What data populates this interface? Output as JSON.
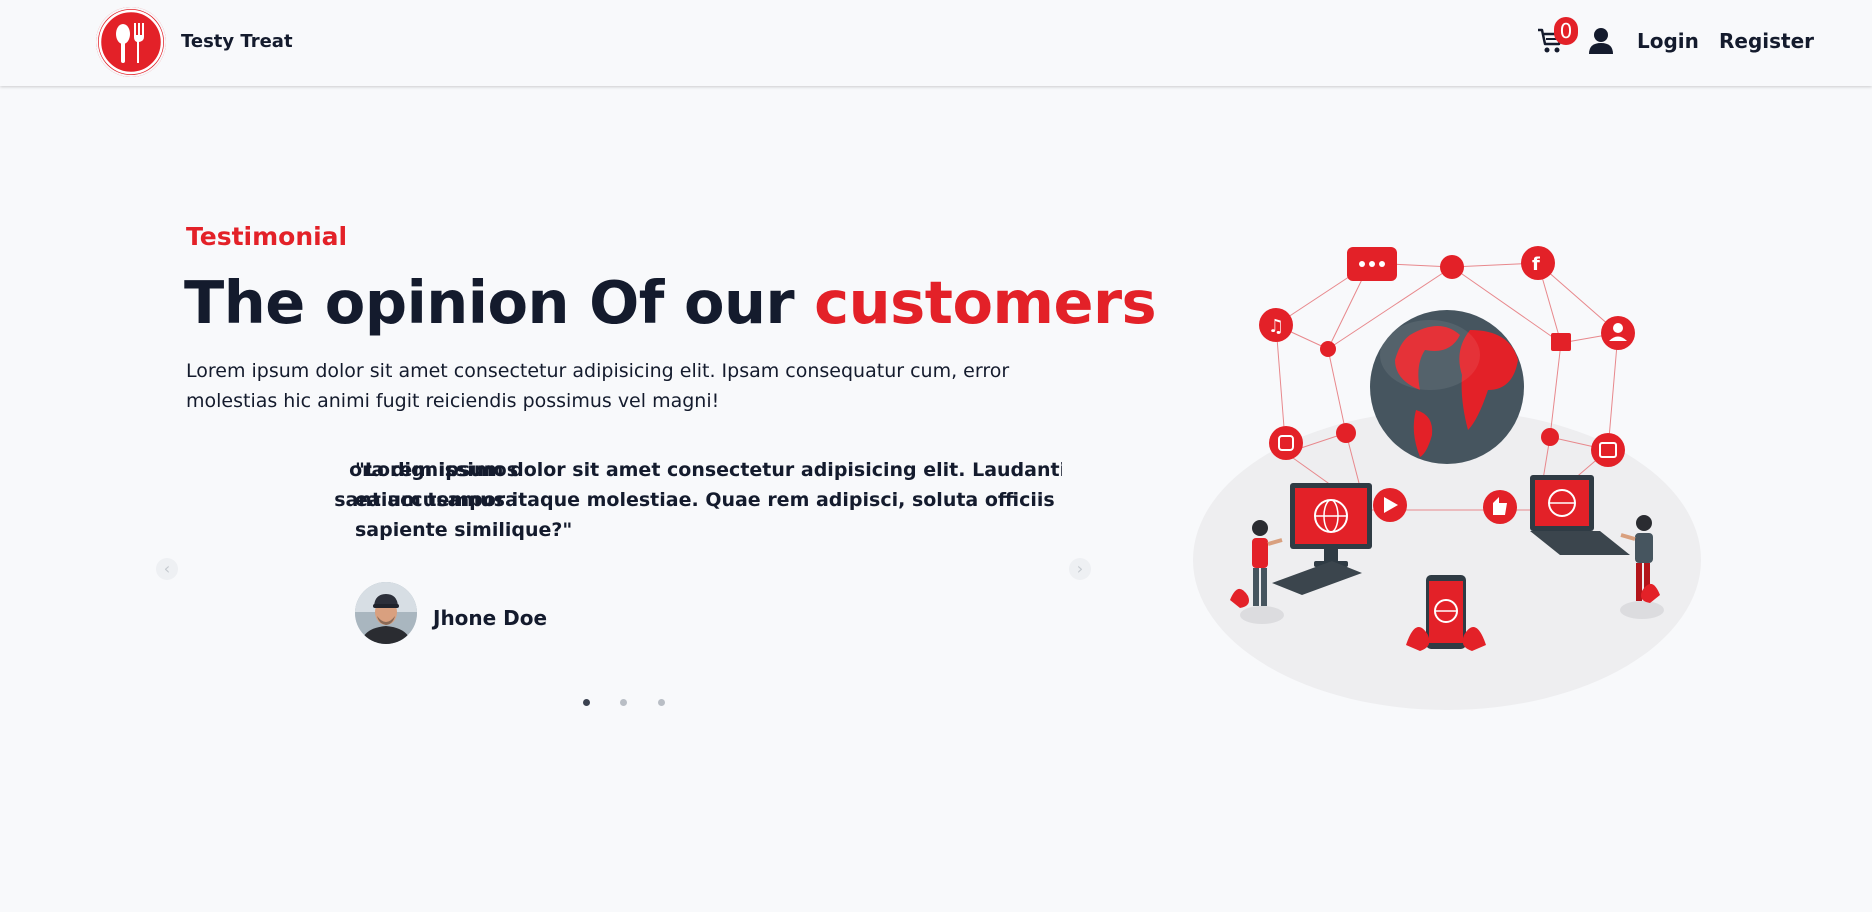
{
  "navbar": {
    "brand_name": "Testy Treat",
    "cart_count": "0",
    "login_label": "Login",
    "register_label": "Register",
    "icons": {
      "logo": "utensils-logo-icon",
      "cart": "shopping-cart-icon",
      "user": "user-icon"
    }
  },
  "hero": {
    "eyebrow": "Testimonial",
    "headline_start": "The opinion Of our ",
    "headline_accent": "customers",
    "intro": "Lorem ipsum dolor sit amet consectetur adipisicing elit. Ipsam consequatur cum, error molestias hic animi fugit reiciendis possimus vel magni!"
  },
  "carousel": {
    "prev_slide_lines": [
      "ora dignissimos",
      "santium tempora"
    ],
    "quote_lines": [
      "\"Lorem ipsum dolor sit amet consectetur adipisicing elit. Laudantium tempo",
      "ea accusamus itaque molestiae. Quae rem adipisci, soluta officiis modi accu",
      "sapiente similique?\""
    ],
    "author": "Jhone Doe",
    "prev_arrow": "‹",
    "next_arrow": "›",
    "slide_count": 3,
    "active_index": 0
  },
  "colors": {
    "accent": "#e32128",
    "text": "#141b2d",
    "background": "#f8f9fb"
  }
}
